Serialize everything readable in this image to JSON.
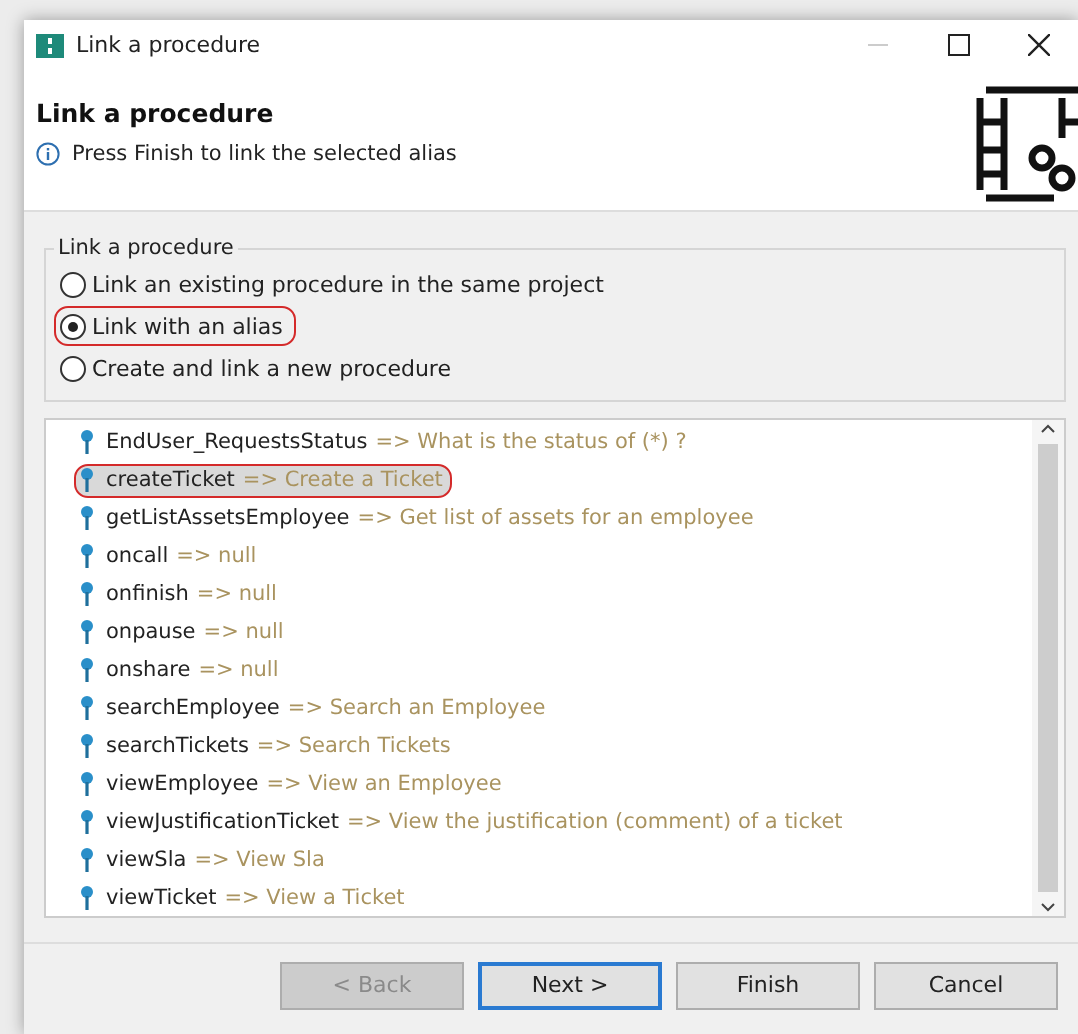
{
  "window": {
    "title": "Link a procedure"
  },
  "header": {
    "title": "Link a procedure",
    "message": "Press Finish to link the selected alias"
  },
  "group": {
    "legend": "Link a procedure",
    "options": [
      {
        "label": "Link an existing procedure in the same project",
        "selected": false,
        "highlighted": false
      },
      {
        "label": "Link with an alias",
        "selected": true,
        "highlighted": true
      },
      {
        "label": "Create and link a new procedure",
        "selected": false,
        "highlighted": false
      }
    ]
  },
  "aliases": [
    {
      "name": "EndUser_RequestsStatus",
      "description": "=> What is the status of (*) ?",
      "selected": false,
      "highlighted": false
    },
    {
      "name": "createTicket",
      "description": "=> Create a Ticket",
      "selected": true,
      "highlighted": true
    },
    {
      "name": "getListAssetsEmployee",
      "description": "=> Get list of assets for an employee",
      "selected": false,
      "highlighted": false
    },
    {
      "name": "oncall",
      "description": "=> null",
      "selected": false,
      "highlighted": false
    },
    {
      "name": "onfinish",
      "description": "=> null",
      "selected": false,
      "highlighted": false
    },
    {
      "name": "onpause",
      "description": "=> null",
      "selected": false,
      "highlighted": false
    },
    {
      "name": "onshare",
      "description": "=> null",
      "selected": false,
      "highlighted": false
    },
    {
      "name": "searchEmployee",
      "description": "=> Search an Employee",
      "selected": false,
      "highlighted": false
    },
    {
      "name": "searchTickets",
      "description": "=> Search Tickets",
      "selected": false,
      "highlighted": false
    },
    {
      "name": "viewEmployee",
      "description": "=> View an Employee",
      "selected": false,
      "highlighted": false
    },
    {
      "name": "viewJustificationTicket",
      "description": "=> View the justification (comment) of a ticket",
      "selected": false,
      "highlighted": false
    },
    {
      "name": "viewSla",
      "description": "=> View Sla",
      "selected": false,
      "highlighted": false
    },
    {
      "name": "viewTicket",
      "description": "=> View a Ticket",
      "selected": false,
      "highlighted": false
    }
  ],
  "buttons": [
    {
      "label": "< Back",
      "disabled": true,
      "default": false
    },
    {
      "label": "Next >",
      "disabled": false,
      "default": true
    },
    {
      "label": "Finish",
      "disabled": false,
      "default": false
    },
    {
      "label": "Cancel",
      "disabled": false,
      "default": false
    }
  ]
}
